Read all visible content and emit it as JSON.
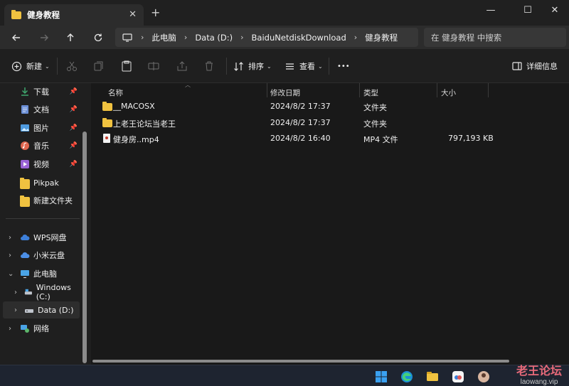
{
  "window": {
    "tab_title": "健身教程",
    "tab_close": "✕",
    "new_tab": "+",
    "minimize": "—",
    "maximize": "☐",
    "close": "✕"
  },
  "address": {
    "breadcrumbs": [
      "此电脑",
      "Data (D:)",
      "BaiduNetdiskDownload",
      "健身教程"
    ],
    "separator": "›",
    "search_placeholder": "在 健身教程 中搜索"
  },
  "toolbar": {
    "new_label": "新建",
    "sort_label": "排序",
    "view_label": "查看",
    "more_label": "•••",
    "details_label": "详细信息",
    "caret": "⌄"
  },
  "sidebar": {
    "pinned": [
      {
        "label": "下载",
        "icon": "download-icon",
        "color": "#3fa56d"
      },
      {
        "label": "文档",
        "icon": "documents-icon",
        "color": "#6b8fd6"
      },
      {
        "label": "图片",
        "icon": "pictures-icon",
        "color": "#4f9be0"
      },
      {
        "label": "音乐",
        "icon": "music-icon",
        "color": "#e0664f"
      },
      {
        "label": "视频",
        "icon": "videos-icon",
        "color": "#9a63d6"
      },
      {
        "label": "Pikpak",
        "icon": "folder-icon",
        "color": "#f0c240"
      },
      {
        "label": "新建文件夹",
        "icon": "folder-icon",
        "color": "#f0c240"
      }
    ],
    "tree": [
      {
        "label": "WPS网盘",
        "icon": "cloud-icon"
      },
      {
        "label": "小米云盘",
        "icon": "cloud-icon"
      },
      {
        "label": "此电脑",
        "icon": "pc-icon"
      },
      {
        "label": "Windows (C:)",
        "icon": "drive-icon"
      },
      {
        "label": "Data (D:)",
        "icon": "drive-icon"
      },
      {
        "label": "网络",
        "icon": "network-icon"
      }
    ],
    "pin": "📌",
    "chev_right": "›",
    "chev_down": "⌄"
  },
  "columns": {
    "name": "名称",
    "modified": "修改日期",
    "type": "类型",
    "size": "大小"
  },
  "files": [
    {
      "name": "__MACOSX",
      "modified": "2024/8/2 17:37",
      "type": "文件夹",
      "size": "",
      "icon": "folder-icon"
    },
    {
      "name": "上老王论坛当老王",
      "modified": "2024/8/2 17:37",
      "type": "文件夹",
      "size": "",
      "icon": "folder-icon"
    },
    {
      "name": "健身房..mp4",
      "modified": "2024/8/2 16:40",
      "type": "MP4 文件",
      "size": "797,193 KB",
      "icon": "video-file-icon"
    }
  ],
  "watermark": {
    "line1": "老王论坛",
    "line2": "laowang.vip"
  }
}
